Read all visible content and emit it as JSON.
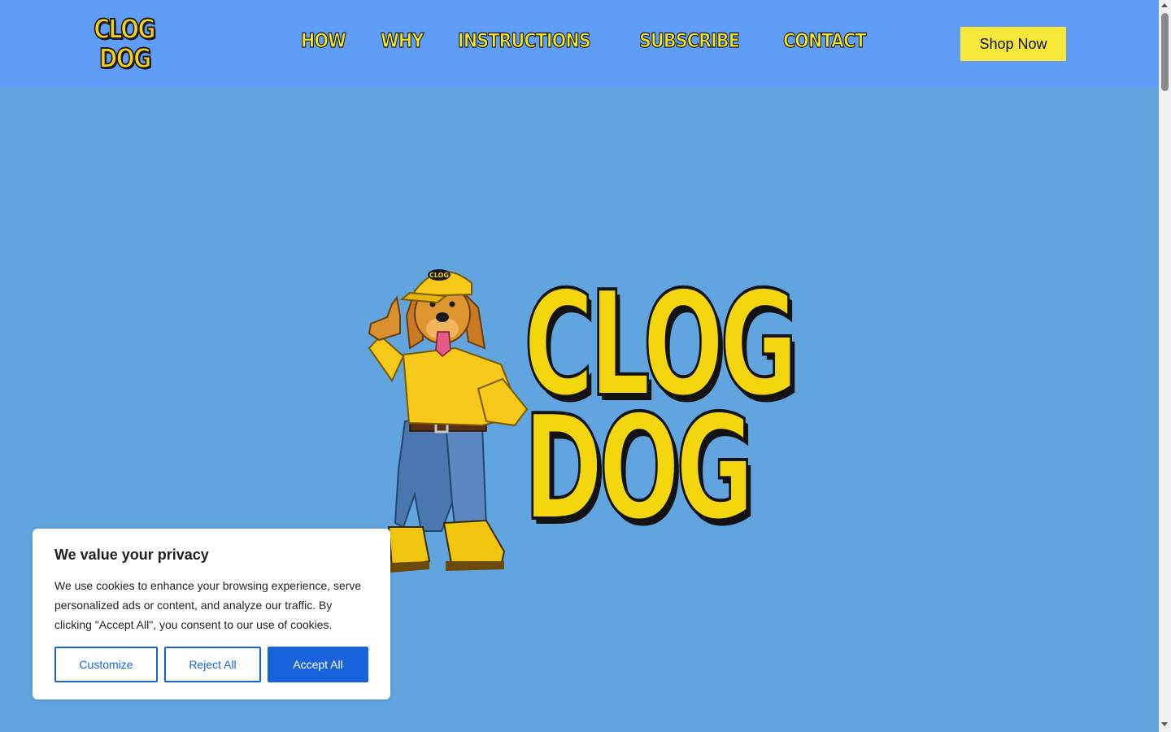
{
  "header": {
    "logo_line1": "CLOG",
    "logo_line2": "DOG",
    "nav": [
      {
        "label": "HOW"
      },
      {
        "label": "WHY"
      },
      {
        "label": "INSTRUCTIONS"
      },
      {
        "label": "SUBSCRIBE"
      },
      {
        "label": "CONTACT"
      }
    ],
    "shop_label": "Shop Now"
  },
  "hero": {
    "line1": "CLOG",
    "line2": "DOG",
    "cap_text": "CLOG"
  },
  "cookie_banner": {
    "title": "We value your privacy",
    "body": "We use cookies to enhance your browsing experience, serve personalized ads or content, and analyze our traffic. By clicking \"Accept All\", you consent to our use of cookies.",
    "customize_label": "Customize",
    "reject_label": "Reject All",
    "accept_label": "Accept All"
  },
  "colors": {
    "header_bg": "#609df8",
    "page_bg": "#60a5e0",
    "brand_yellow": "#f7e83a",
    "consent_blue": "#1863dc"
  }
}
